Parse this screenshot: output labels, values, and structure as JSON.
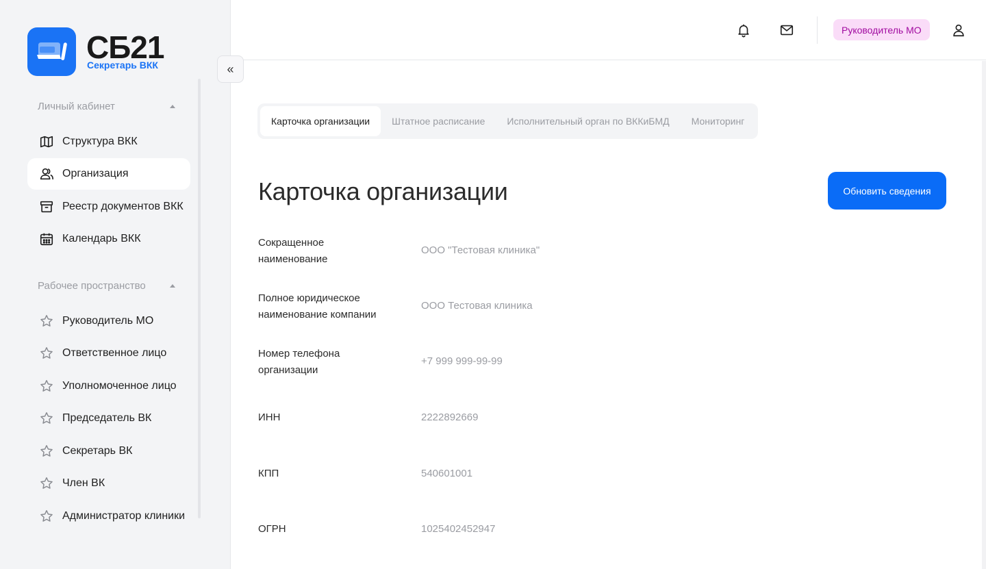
{
  "brand": {
    "title": "СБ21",
    "subtitle": "Секретарь ВКК",
    "accent": "#1a73f5"
  },
  "sidebar": {
    "section1": {
      "label": "Личный кабинет"
    },
    "items1": [
      {
        "label": "Структура ВКК",
        "icon": "map-icon"
      },
      {
        "label": "Организация",
        "icon": "users-icon",
        "active": true
      },
      {
        "label": "Реестр документов ВКК",
        "icon": "archive-icon"
      },
      {
        "label": "Календарь ВКК",
        "icon": "calendar-icon"
      }
    ],
    "section2": {
      "label": "Рабочее пространство"
    },
    "items2": [
      {
        "label": "Руководитель МО",
        "icon": "star-icon"
      },
      {
        "label": "Ответственное лицо",
        "icon": "star-icon"
      },
      {
        "label": "Уполномоченное лицо",
        "icon": "star-icon"
      },
      {
        "label": "Председатель ВК",
        "icon": "star-icon"
      },
      {
        "label": "Секретарь ВК",
        "icon": "star-icon"
      },
      {
        "label": "Член ВК",
        "icon": "star-icon"
      },
      {
        "label": "Администратор клиники",
        "icon": "star-icon"
      }
    ]
  },
  "collapse": {
    "glyph": "«"
  },
  "header": {
    "role_badge": "Руководитель МО",
    "badge_bg": "#fadcf8",
    "badge_color": "#a10ba0"
  },
  "tabs": [
    {
      "label": "Карточка организации",
      "active": true
    },
    {
      "label": "Штатное расписание"
    },
    {
      "label": "Исполнительный орган по ВККиБМД"
    },
    {
      "label": "Мониторинг"
    }
  ],
  "page": {
    "title": "Карточка организации",
    "update_button": "Обновить сведения",
    "button_color": "#0a6cf7"
  },
  "fields": [
    {
      "label": "Сокращенное наименование",
      "value": "ООО \"Тестовая клиника\""
    },
    {
      "label": "Полное юридическое наименование компании",
      "value": "ООО Тестовая клиника"
    },
    {
      "label": "Номер телефона организации",
      "value": "+7 999 999-99-99"
    },
    {
      "label": "ИНН",
      "value": "2222892669"
    },
    {
      "label": "КПП",
      "value": "540601001"
    },
    {
      "label": "ОГРН",
      "value": "1025402452947"
    }
  ]
}
